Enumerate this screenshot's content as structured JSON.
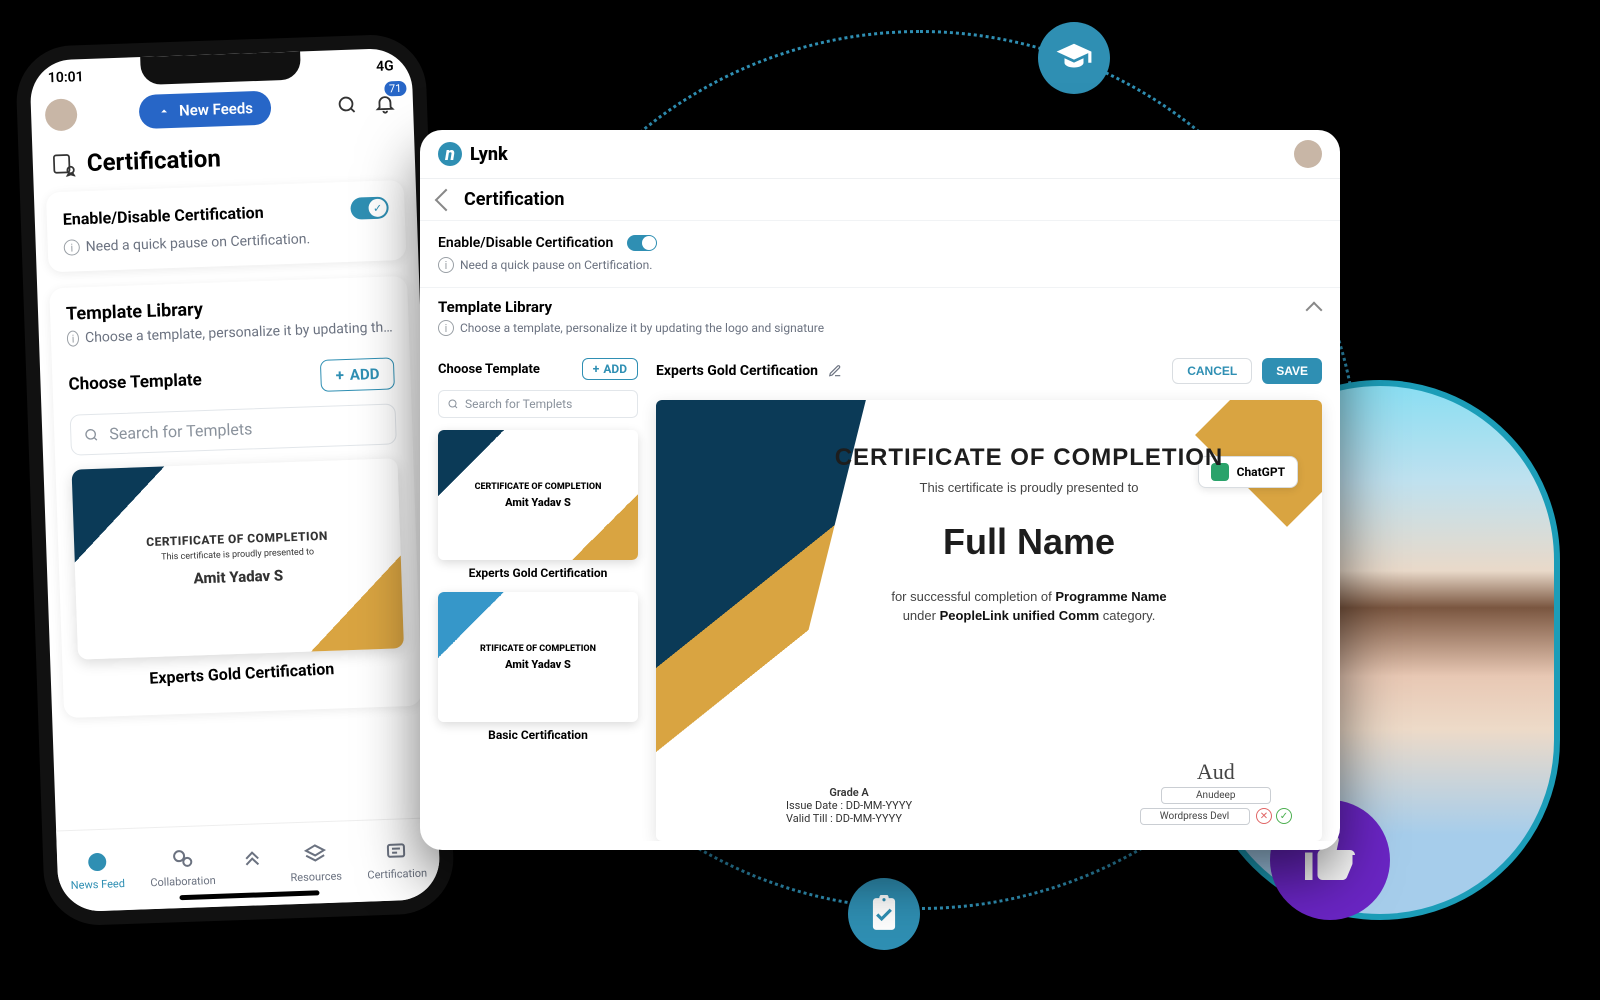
{
  "status": {
    "time": "10:01",
    "network": "4G"
  },
  "header": {
    "new_feeds": "New Feeds",
    "notif_count": "71"
  },
  "page_title_mobile": "Certification",
  "enable_card": {
    "label": "Enable/Disable Certification",
    "hint": "Need a quick pause on Certification."
  },
  "library": {
    "title": "Template Library",
    "hint": "Choose a template, personalize it by updating the logo and signature",
    "choose_label": "Choose Template",
    "add_label": "ADD",
    "search_placeholder": "Search for Templets"
  },
  "templates": [
    {
      "name": "Experts Gold Certification",
      "thumb_title": "CERTIFICATE OF COMPLETION",
      "thumb_sub": "This certificate is proudly presented to",
      "sample_name": "Amit Yadav S"
    },
    {
      "name": "Basic Certification",
      "thumb_title": "RTIFICATE OF COMPLETION",
      "thumb_sub": "",
      "sample_name": "Amit Yadav S"
    }
  ],
  "tabs": {
    "news": "News Feed",
    "collab": "Collaboration",
    "resources": "Resources",
    "cert": "Certification"
  },
  "desktop": {
    "brand": "Lynk",
    "page_title": "Certification",
    "editor": {
      "title": "Experts Gold Certification",
      "cancel": "CANCEL",
      "save": "SAVE",
      "chat_label": "ChatGPT"
    },
    "cert": {
      "title": "CERTIFICATE OF COMPLETION",
      "sub": "This certificate is proudly presented to",
      "name": "Full Name",
      "line1a": "for successful completion of ",
      "line1b": "Programme Name",
      "line2a": "under ",
      "line2b": "PeopleLink unified Comm",
      "line2c": " category.",
      "grade": "Grade A",
      "issue": "Issue Date : DD-MM-YYYY",
      "valid": "Valid Till : DD-MM-YYYY",
      "signer_name": "Anudeep",
      "signer_role": "Wordpress Devl"
    }
  }
}
